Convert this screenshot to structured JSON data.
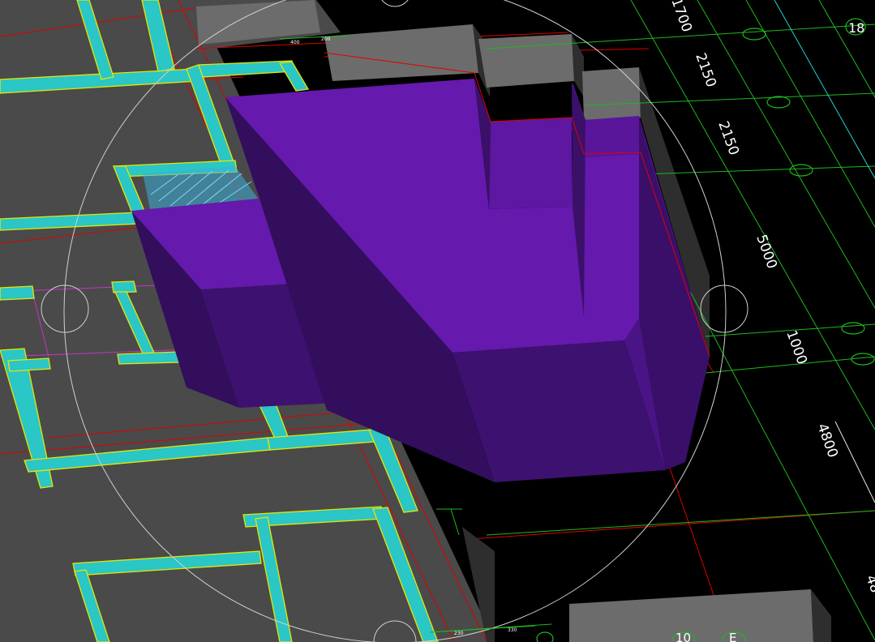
{
  "viewport": {
    "background": "#000000",
    "colors": {
      "floor": "#4a4a4a",
      "wall_hatch": "#2bc6c6",
      "wall_outline": "#e6e600",
      "red_line": "#e00000",
      "grid_green": "#1db91d",
      "grid_cyan": "#27d3d3",
      "purple_top": "#6519ad",
      "purple_front": "#3d1170",
      "purple_side": "#320e5c",
      "gray_block_top": "#6c6c6c",
      "gray_block_side": "#2e2e2e",
      "magenta": "#c832c8",
      "gizmo": "#cfcfcf"
    }
  },
  "grid_bubbles": [
    {
      "id": "b18",
      "label": "18"
    },
    {
      "id": "b10",
      "label": "10"
    },
    {
      "id": "bE",
      "label": "E"
    }
  ],
  "dimensions": [
    {
      "id": "d1700",
      "text": "1700"
    },
    {
      "id": "d2150a",
      "text": "2150"
    },
    {
      "id": "d2150b",
      "text": "2150"
    },
    {
      "id": "d5000",
      "text": "5000"
    },
    {
      "id": "d1000",
      "text": "1000"
    },
    {
      "id": "d4800",
      "text": "4800"
    },
    {
      "id": "d48",
      "text": "48"
    }
  ],
  "small_labels": [
    {
      "id": "s400",
      "text": "400"
    },
    {
      "id": "s200",
      "text": "200"
    },
    {
      "id": "s230",
      "text": "230"
    },
    {
      "id": "s330",
      "text": "330"
    }
  ]
}
